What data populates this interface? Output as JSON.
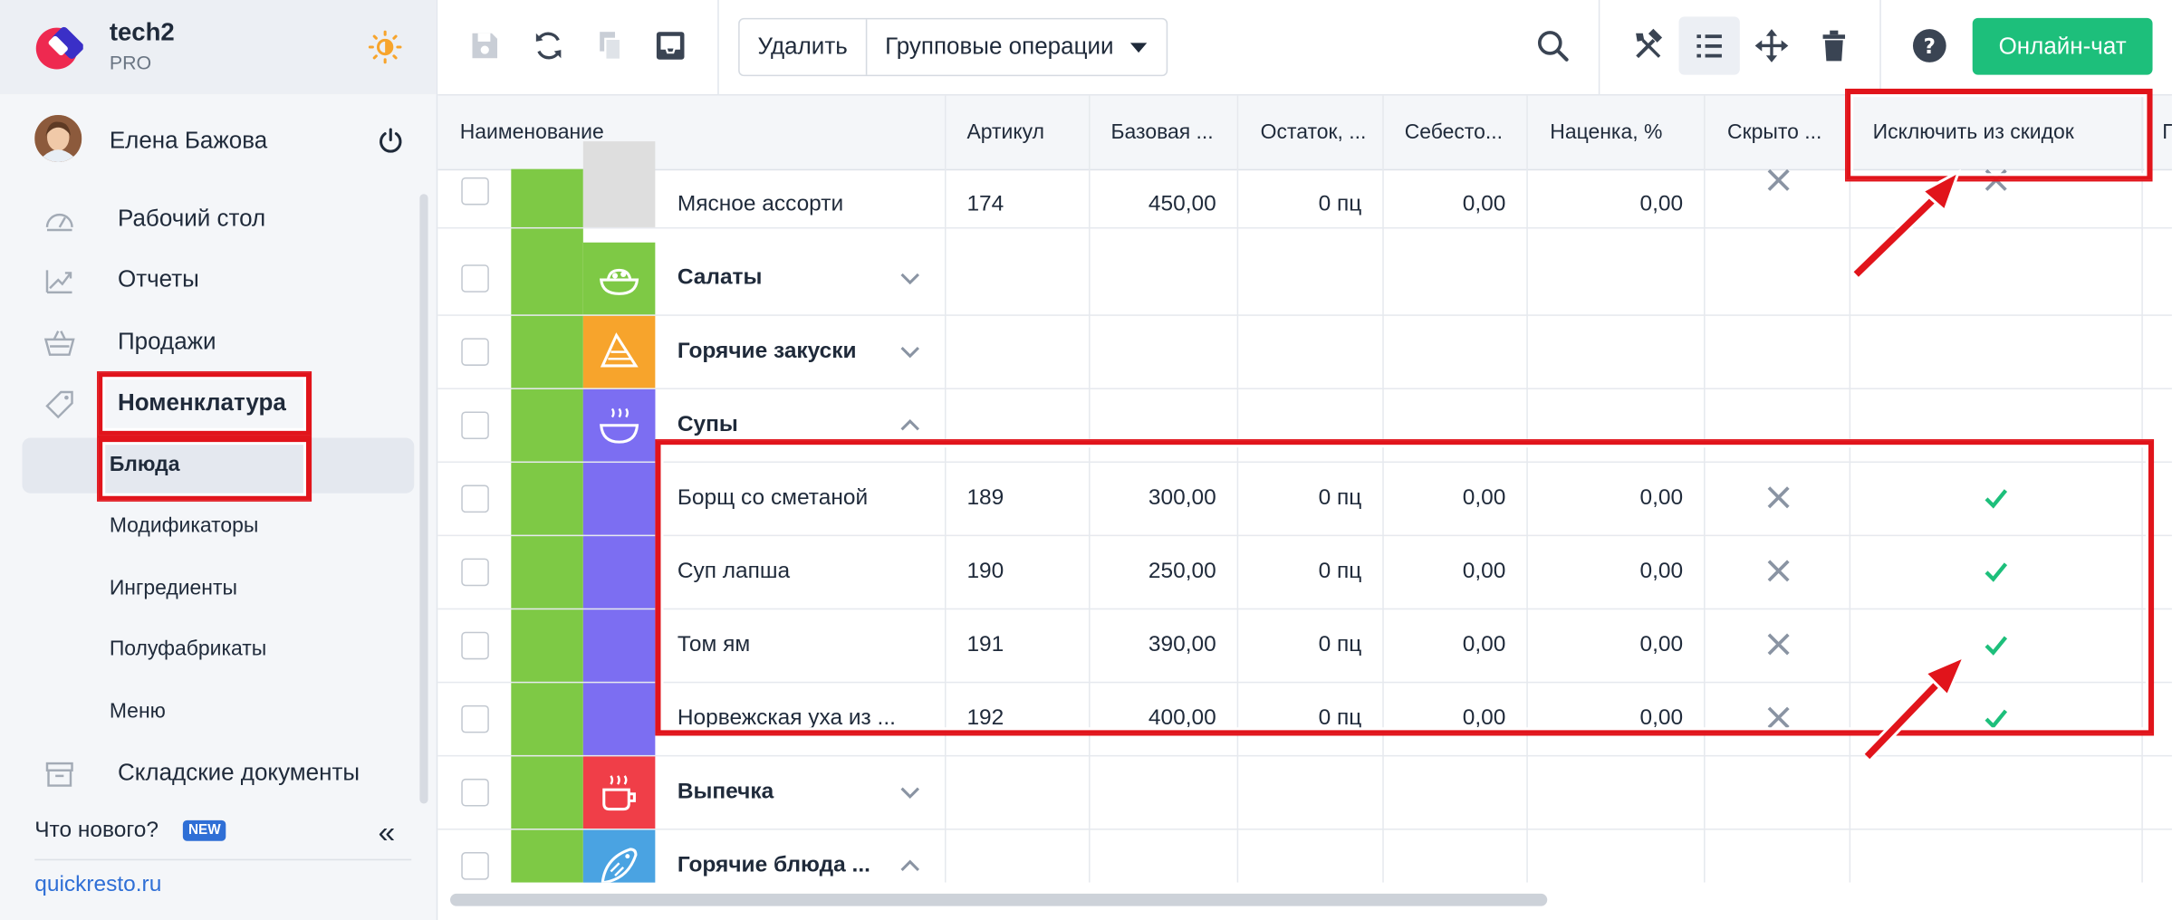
{
  "brand": {
    "name": "tech2",
    "plan": "PRO"
  },
  "user": {
    "name": "Елена Бажова"
  },
  "nav": {
    "items": [
      {
        "label": "Рабочий стол",
        "icon": "dashboard-icon"
      },
      {
        "label": "Отчеты",
        "icon": "chart-icon"
      },
      {
        "label": "Продажи",
        "icon": "basket-icon"
      },
      {
        "label": "Номенклатура",
        "icon": "tag-icon"
      }
    ],
    "sub": [
      "Блюда",
      "Модификаторы",
      "Ингредиенты",
      "Полуфабрикаты",
      "Меню"
    ],
    "warehouse": {
      "label": "Складские документы",
      "icon": "archive-icon"
    }
  },
  "footer": {
    "whats_new": "Что нового?",
    "badge": "NEW",
    "site": "quickresto.ru"
  },
  "toolbar": {
    "delete": "Удалить",
    "group_ops": "Групповые операции",
    "chat": "Онлайн-чат"
  },
  "columns": [
    "Наименование",
    "Артикул",
    "Базовая ...",
    "Остаток, ...",
    "Себесто...",
    "Наценка, %",
    "Скрыто ...",
    "Исключить из скидок",
    "П"
  ],
  "rows": [
    {
      "type": "item",
      "name": "Мясное ассорти",
      "sku": "174",
      "price": "450,00",
      "stock": "0 пц",
      "cost": "0,00",
      "markup": "0,00",
      "hidden": false,
      "exclude": false
    },
    {
      "type": "category",
      "name": "Салаты",
      "expanded": false,
      "color": "#7ec945",
      "icon": "salad-icon"
    },
    {
      "type": "category",
      "name": "Горячие закуски",
      "expanded": false,
      "color": "#f7a42c",
      "icon": "snacks-icon"
    },
    {
      "type": "category",
      "name": "Супы",
      "expanded": true,
      "color": "#7c6ef2",
      "icon": "soup-icon"
    },
    {
      "type": "item",
      "name": "Борщ со сметаной",
      "sku": "189",
      "price": "300,00",
      "stock": "0 пц",
      "cost": "0,00",
      "markup": "0,00",
      "hidden": false,
      "exclude": true
    },
    {
      "type": "item",
      "name": "Суп лапша",
      "sku": "190",
      "price": "250,00",
      "stock": "0 пц",
      "cost": "0,00",
      "markup": "0,00",
      "hidden": false,
      "exclude": true
    },
    {
      "type": "item",
      "name": "Том ям",
      "sku": "191",
      "price": "390,00",
      "stock": "0 пц",
      "cost": "0,00",
      "markup": "0,00",
      "hidden": false,
      "exclude": true
    },
    {
      "type": "item",
      "name": "Норвежская уха из ...",
      "sku": "192",
      "price": "400,00",
      "stock": "0 пц",
      "cost": "0,00",
      "markup": "0,00",
      "hidden": false,
      "exclude": true
    },
    {
      "type": "category",
      "name": "Выпечка",
      "expanded": false,
      "color": "#f03e48",
      "icon": "coffee-cup-icon"
    },
    {
      "type": "category",
      "name": "Горячие блюда ...",
      "expanded": true,
      "color": "#4aa3e2",
      "icon": "fish-icon"
    }
  ],
  "colors": {
    "accent_green": "#1dbf7b",
    "highlight_red": "#e1141b",
    "check_green": "#1dbf7b",
    "cross": "#8a94a3"
  }
}
